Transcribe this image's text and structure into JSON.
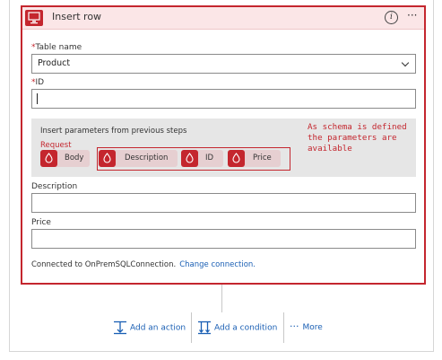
{
  "card": {
    "title": "Insert row",
    "icons": {
      "app": "sql-server-icon",
      "info": "info-icon",
      "more": "ellipsis-icon"
    },
    "more_glyph": "···",
    "info_glyph": "i"
  },
  "fields": {
    "table_name": {
      "required_mark": "*",
      "label": "Table name",
      "value": "Product"
    },
    "id": {
      "required_mark": "*",
      "label": "ID",
      "value": ""
    },
    "description": {
      "label": "Description",
      "value": ""
    },
    "price": {
      "label": "Price",
      "value": ""
    }
  },
  "parameters": {
    "heading": "Insert parameters from previous steps",
    "group": "Request",
    "tokens": [
      "Body",
      "Description",
      "ID",
      "Price"
    ],
    "annotation": "As schema is defined\nthe parameters are\navailable"
  },
  "connection": {
    "text": "Connected to OnPremSQLConnection.",
    "link": "Change connection."
  },
  "actions": {
    "add_action": "Add an action",
    "add_condition": "Add a condition",
    "more": "More",
    "more_glyph": "···"
  },
  "colors": {
    "accent": "#c4262e",
    "header_bg": "#fbe6e7",
    "link": "#1a5fb4"
  }
}
